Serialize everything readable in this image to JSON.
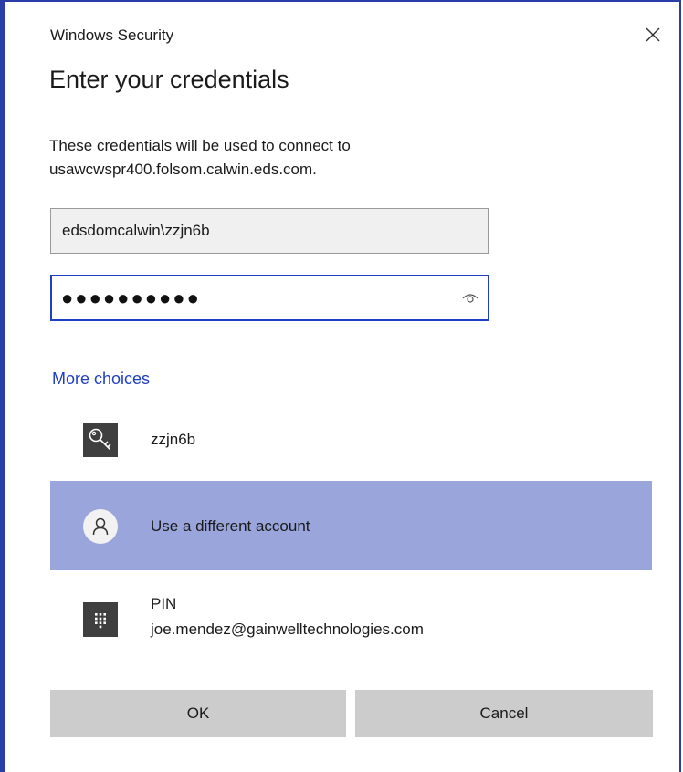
{
  "window": {
    "title": "Windows Security",
    "close_icon": "close-icon",
    "accent_color": "#1f3fc4",
    "frame_color": "#2b3ea8"
  },
  "header": {
    "heading": "Enter your credentials"
  },
  "description": {
    "line1": "These credentials will be used to connect to",
    "line2": "usawcwspr400.folsom.calwin.eds.com."
  },
  "form": {
    "username_value": "edsdomcalwin\\zzjn6b",
    "password_masked": "●●●●●●●●●●",
    "reveal_icon": "eye-icon"
  },
  "more_choices": {
    "label": "More choices"
  },
  "choices": [
    {
      "icon": "key-icon",
      "label": "zzjn6b"
    },
    {
      "icon": "person-icon",
      "label": "Use a different account",
      "selected": true,
      "highlight_color": "#9aa5dc"
    },
    {
      "icon": "pin-keypad-icon",
      "label": "PIN",
      "sublabel": "joe.mendez@gainwelltechnologies.com"
    }
  ],
  "buttons": {
    "ok_label": "OK",
    "cancel_label": "Cancel",
    "button_color": "#cccccc"
  }
}
